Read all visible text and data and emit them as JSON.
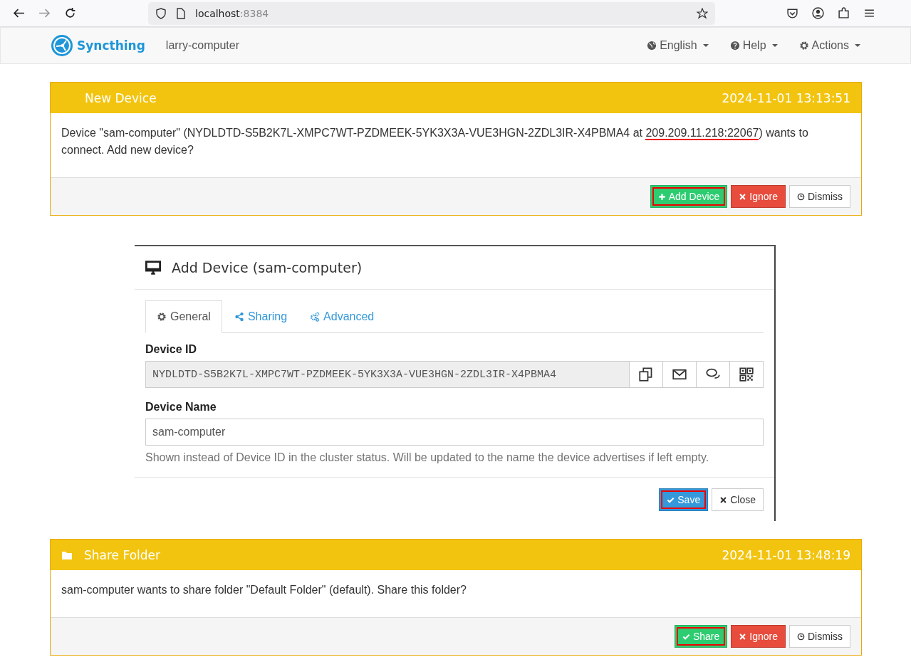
{
  "browser": {
    "host": "localhost",
    "port": ":8384"
  },
  "navbar": {
    "brand": "Syncthing",
    "device_name": "larry-computer",
    "menus": [
      {
        "label": "English"
      },
      {
        "label": "Help"
      },
      {
        "label": "Actions"
      }
    ]
  },
  "new_device_panel": {
    "title": "New Device",
    "time": "2024-11-01 13:13:51",
    "message": {
      "before": "Device \"sam-computer\" (NYDLDTD-S5B2K7L-XMPC7WT-PZDMEEK-5YK3X3A-VUE3HGN-2ZDL3IR-X4PBMA4 at ",
      "link": "209.209.11.218:22067",
      "link_highlighted": true,
      "after": ") wants to connect. Add new device?"
    },
    "buttons": [
      {
        "label": "Add Device",
        "kind": "success",
        "highlighted": true
      },
      {
        "label": "Ignore",
        "kind": "danger",
        "highlighted": false
      },
      {
        "label": "Dismiss",
        "kind": "default",
        "highlighted": false
      }
    ]
  },
  "modal": {
    "title": "Add Device (sam-computer)",
    "tabs": [
      {
        "label": "General",
        "selected": true
      },
      {
        "label": "Sharing",
        "selected": false
      },
      {
        "label": "Advanced",
        "selected": false
      }
    ],
    "device_id": {
      "label": "Device ID",
      "value": "NYDLDTD-S5B2K7L-XMPC7WT-PZDMEEK-5YK3X3A-VUE3HGN-2ZDL3IR-X4PBMA4"
    },
    "device_name": {
      "label": "Device Name",
      "value": "sam-computer",
      "help": "Shown instead of Device ID in the cluster status. Will be updated to the name the device advertises if left empty."
    },
    "buttons": [
      {
        "label": "Save",
        "kind": "primary",
        "highlighted": true
      },
      {
        "label": "Close",
        "kind": "default",
        "highlighted": false
      }
    ]
  },
  "share_folder_panel": {
    "title": "Share Folder",
    "time": "2024-11-01 13:48:19",
    "message": {
      "before": "sam-computer wants to share folder \"Default Folder\" (default). Share this folder?"
    },
    "buttons": [
      {
        "label": "Share",
        "kind": "success",
        "highlighted": true
      },
      {
        "label": "Ignore",
        "kind": "danger",
        "highlighted": false
      },
      {
        "label": "Dismiss",
        "kind": "default",
        "highlighted": false
      }
    ]
  }
}
